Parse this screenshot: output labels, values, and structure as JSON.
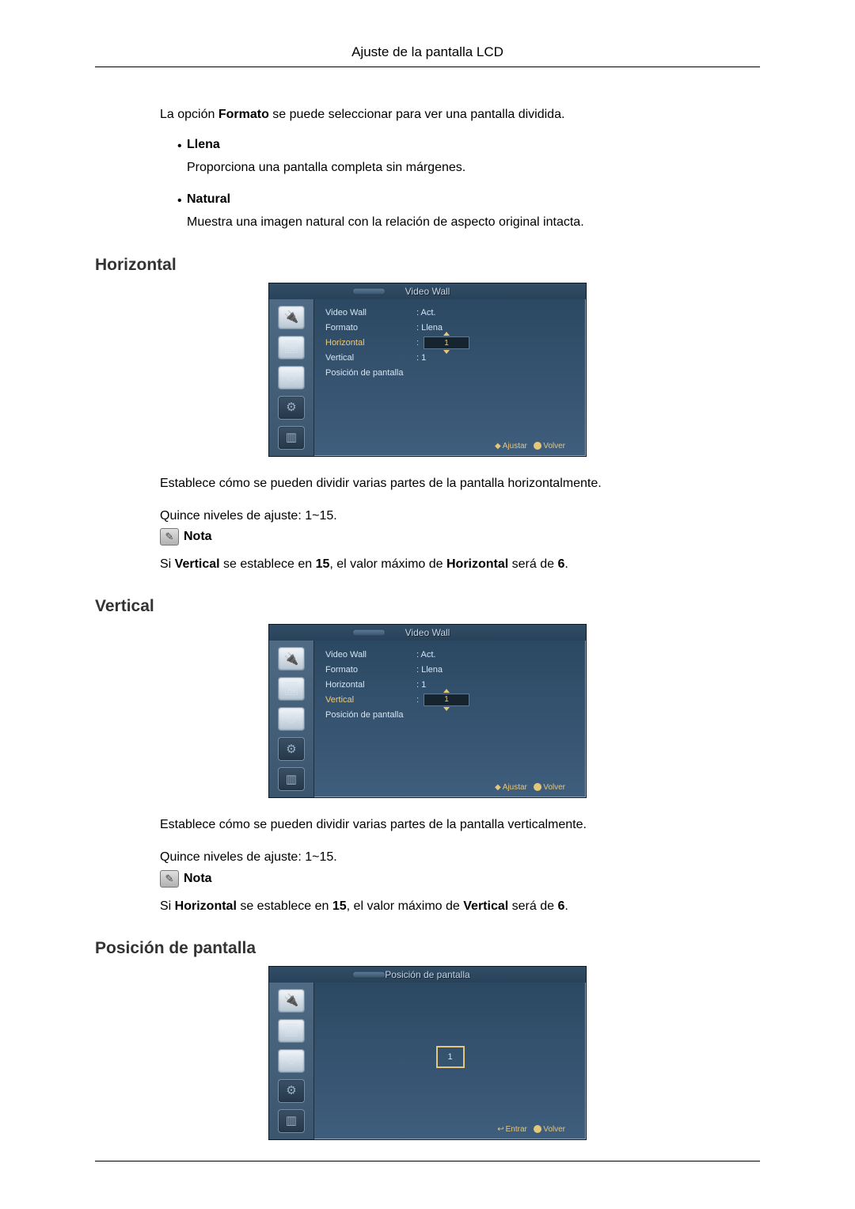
{
  "header": {
    "title": "Ajuste de la pantalla LCD"
  },
  "intro": {
    "para_pre": "La opción ",
    "para_bold": "Formato",
    "para_post": " se puede seleccionar para ver una pantalla dividida."
  },
  "bullets": [
    {
      "label": "Llena",
      "desc": "Proporciona una pantalla completa sin márgenes."
    },
    {
      "label": "Natural",
      "desc": "Muestra una imagen natural con la relación de aspecto original intacta."
    }
  ],
  "sections": {
    "horizontal": {
      "heading": "Horizontal",
      "desc": "Establece cómo se pueden dividir varias partes de la pantalla horizontalmente.",
      "levels": "Quince niveles de ajuste: 1~15.",
      "note_label": "Nota",
      "note_pre": "Si ",
      "note_b1": "Vertical",
      "note_mid": " se establece en ",
      "note_b2": "15",
      "note_mid2": ", el valor máximo de ",
      "note_b3": "Horizontal",
      "note_post": " será de ",
      "note_b4": "6",
      "note_end": "."
    },
    "vertical": {
      "heading": "Vertical",
      "desc": "Establece cómo se pueden dividir varias partes de la pantalla verticalmente.",
      "levels": "Quince niveles de ajuste: 1~15.",
      "note_label": "Nota",
      "note_pre": "Si ",
      "note_b1": "Horizontal",
      "note_mid": " se establece en ",
      "note_b2": "15",
      "note_mid2": ", el valor máximo de ",
      "note_b3": "Vertical",
      "note_post": " será de ",
      "note_b4": "6",
      "note_end": "."
    },
    "position": {
      "heading": "Posición de pantalla"
    }
  },
  "osd": {
    "videowall_title": "Video Wall",
    "position_title": "Posición de pantalla",
    "rows": {
      "video_wall": {
        "label": "Video Wall",
        "value": ": Act."
      },
      "formato": {
        "label": "Formato",
        "value": ": Llena"
      },
      "horizontal": {
        "label": "Horizontal",
        "value_plain": ": 1",
        "spin": "1"
      },
      "vertical": {
        "label": "Vertical",
        "value_plain": ": 1",
        "spin": "1"
      },
      "posicion": {
        "label": "Posición de pantalla",
        "value": ""
      }
    },
    "footer": {
      "ajustar_sym": "◆",
      "ajustar": "Ajustar",
      "entrar_sym": "↩",
      "entrar": "Entrar",
      "volver": "Volver"
    },
    "position_value": "1"
  }
}
